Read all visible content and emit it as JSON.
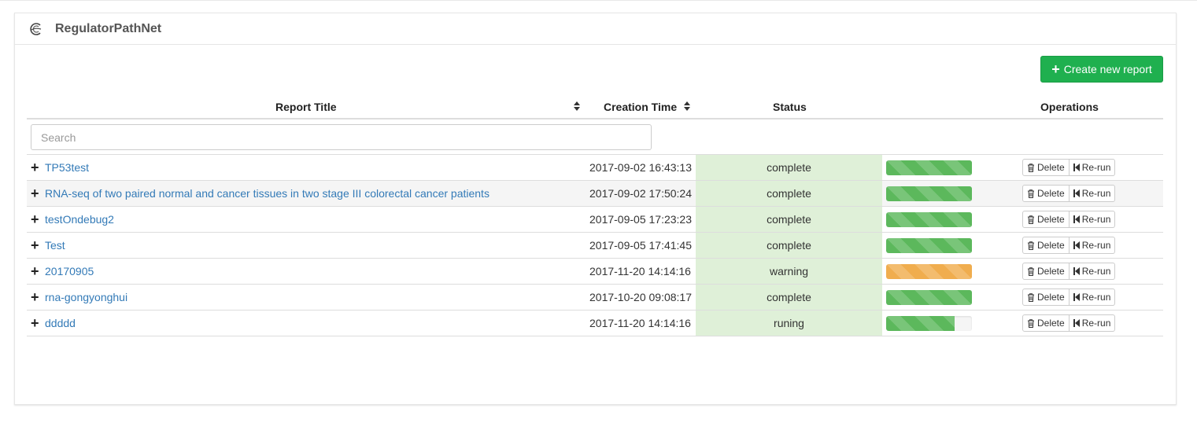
{
  "app": {
    "title": "RegulatorPathNet"
  },
  "toolbar": {
    "create_label": "Create new report"
  },
  "table": {
    "headers": {
      "title": "Report Title",
      "ctime": "Creation Time",
      "status": "Status",
      "operations": "Operations"
    },
    "search_placeholder": "Search",
    "rows": [
      {
        "title": "TP53test",
        "ctime": "2017-09-02 16:43:13",
        "status": "complete",
        "progress": 100,
        "progress_type": "success"
      },
      {
        "title": "RNA-seq of two paired normal and cancer tissues in two stage III colorectal cancer patients",
        "ctime": "2017-09-02 17:50:24",
        "status": "complete",
        "progress": 100,
        "progress_type": "success"
      },
      {
        "title": "testOndebug2",
        "ctime": "2017-09-05 17:23:23",
        "status": "complete",
        "progress": 100,
        "progress_type": "success"
      },
      {
        "title": "Test",
        "ctime": "2017-09-05 17:41:45",
        "status": "complete",
        "progress": 100,
        "progress_type": "success"
      },
      {
        "title": "20170905",
        "ctime": "2017-11-20 14:14:16",
        "status": "warning",
        "progress": 100,
        "progress_type": "warning"
      },
      {
        "title": "rna-gongyonghui",
        "ctime": "2017-10-20 09:08:17",
        "status": "complete",
        "progress": 100,
        "progress_type": "success"
      },
      {
        "title": "ddddd",
        "ctime": "2017-11-20 14:14:16",
        "status": "runing",
        "progress": 80,
        "progress_type": "success"
      }
    ],
    "delete_label": "Delete",
    "rerun_label": "Re-run"
  },
  "colors": {
    "accent_green": "#1fb04f",
    "status_bg": "#dff0d8",
    "progress_success": "#5cb85c",
    "progress_warning": "#f0ad4e",
    "link": "#337ab7"
  }
}
